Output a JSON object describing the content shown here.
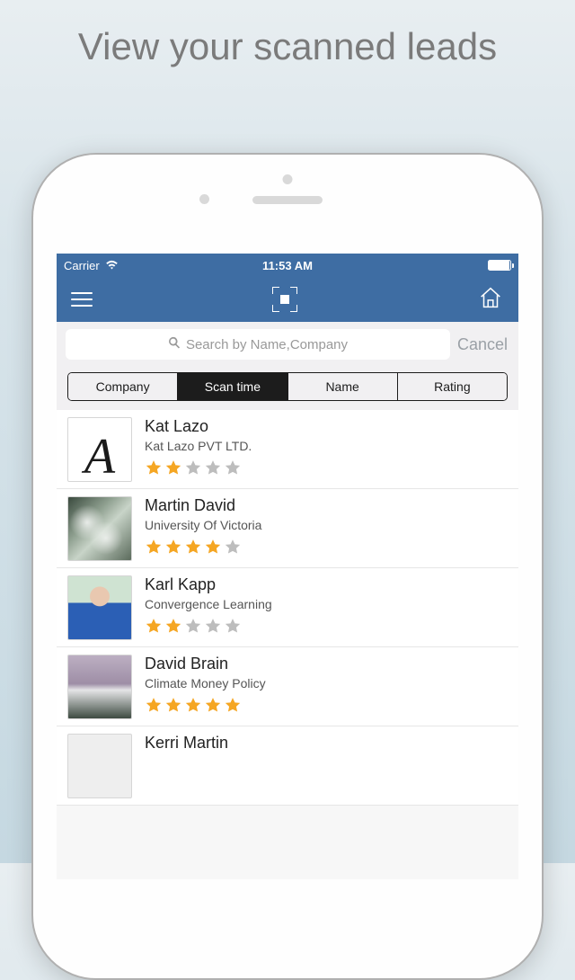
{
  "marketing": {
    "title": "View your scanned leads"
  },
  "status": {
    "carrier": "Carrier",
    "time": "11:53 AM"
  },
  "search": {
    "placeholder": "Search by Name,Company",
    "cancel": "Cancel"
  },
  "tabs": {
    "items": [
      "Company",
      "Scan time",
      "Name",
      "Rating"
    ],
    "active_index": 1
  },
  "leads": [
    {
      "name": "Kat Lazo",
      "company": "Kat Lazo PVT LTD.",
      "rating": 2,
      "avatar": "calligraphic-a"
    },
    {
      "name": "Martin David",
      "company": "University Of Victoria",
      "rating": 4,
      "avatar": "waterfall"
    },
    {
      "name": "Karl Kapp",
      "company": "Convergence Learning",
      "rating": 2,
      "avatar": "person-blue"
    },
    {
      "name": "David Brain",
      "company": "Climate Money Policy",
      "rating": 5,
      "avatar": "falls"
    },
    {
      "name": "Kerri Martin",
      "company": "",
      "rating": 0,
      "avatar": "blank"
    }
  ]
}
